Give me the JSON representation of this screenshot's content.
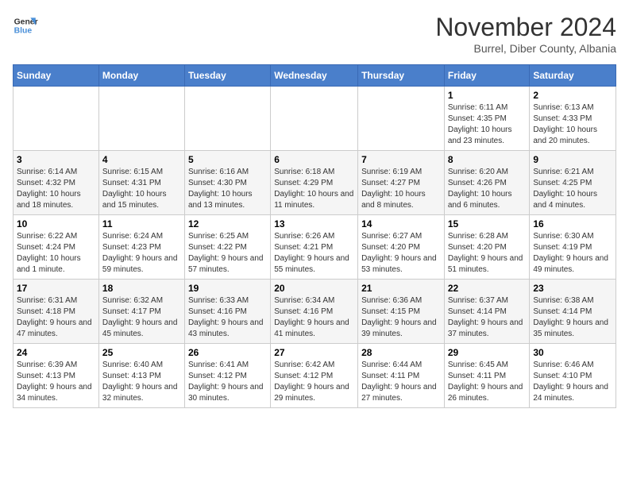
{
  "logo": {
    "line1": "General",
    "line2": "Blue"
  },
  "title": "November 2024",
  "subtitle": "Burrel, Diber County, Albania",
  "days_of_week": [
    "Sunday",
    "Monday",
    "Tuesday",
    "Wednesday",
    "Thursday",
    "Friday",
    "Saturday"
  ],
  "weeks": [
    [
      {
        "day": "",
        "info": ""
      },
      {
        "day": "",
        "info": ""
      },
      {
        "day": "",
        "info": ""
      },
      {
        "day": "",
        "info": ""
      },
      {
        "day": "",
        "info": ""
      },
      {
        "day": "1",
        "info": "Sunrise: 6:11 AM\nSunset: 4:35 PM\nDaylight: 10 hours and 23 minutes."
      },
      {
        "day": "2",
        "info": "Sunrise: 6:13 AM\nSunset: 4:33 PM\nDaylight: 10 hours and 20 minutes."
      }
    ],
    [
      {
        "day": "3",
        "info": "Sunrise: 6:14 AM\nSunset: 4:32 PM\nDaylight: 10 hours and 18 minutes."
      },
      {
        "day": "4",
        "info": "Sunrise: 6:15 AM\nSunset: 4:31 PM\nDaylight: 10 hours and 15 minutes."
      },
      {
        "day": "5",
        "info": "Sunrise: 6:16 AM\nSunset: 4:30 PM\nDaylight: 10 hours and 13 minutes."
      },
      {
        "day": "6",
        "info": "Sunrise: 6:18 AM\nSunset: 4:29 PM\nDaylight: 10 hours and 11 minutes."
      },
      {
        "day": "7",
        "info": "Sunrise: 6:19 AM\nSunset: 4:27 PM\nDaylight: 10 hours and 8 minutes."
      },
      {
        "day": "8",
        "info": "Sunrise: 6:20 AM\nSunset: 4:26 PM\nDaylight: 10 hours and 6 minutes."
      },
      {
        "day": "9",
        "info": "Sunrise: 6:21 AM\nSunset: 4:25 PM\nDaylight: 10 hours and 4 minutes."
      }
    ],
    [
      {
        "day": "10",
        "info": "Sunrise: 6:22 AM\nSunset: 4:24 PM\nDaylight: 10 hours and 1 minute."
      },
      {
        "day": "11",
        "info": "Sunrise: 6:24 AM\nSunset: 4:23 PM\nDaylight: 9 hours and 59 minutes."
      },
      {
        "day": "12",
        "info": "Sunrise: 6:25 AM\nSunset: 4:22 PM\nDaylight: 9 hours and 57 minutes."
      },
      {
        "day": "13",
        "info": "Sunrise: 6:26 AM\nSunset: 4:21 PM\nDaylight: 9 hours and 55 minutes."
      },
      {
        "day": "14",
        "info": "Sunrise: 6:27 AM\nSunset: 4:20 PM\nDaylight: 9 hours and 53 minutes."
      },
      {
        "day": "15",
        "info": "Sunrise: 6:28 AM\nSunset: 4:20 PM\nDaylight: 9 hours and 51 minutes."
      },
      {
        "day": "16",
        "info": "Sunrise: 6:30 AM\nSunset: 4:19 PM\nDaylight: 9 hours and 49 minutes."
      }
    ],
    [
      {
        "day": "17",
        "info": "Sunrise: 6:31 AM\nSunset: 4:18 PM\nDaylight: 9 hours and 47 minutes."
      },
      {
        "day": "18",
        "info": "Sunrise: 6:32 AM\nSunset: 4:17 PM\nDaylight: 9 hours and 45 minutes."
      },
      {
        "day": "19",
        "info": "Sunrise: 6:33 AM\nSunset: 4:16 PM\nDaylight: 9 hours and 43 minutes."
      },
      {
        "day": "20",
        "info": "Sunrise: 6:34 AM\nSunset: 4:16 PM\nDaylight: 9 hours and 41 minutes."
      },
      {
        "day": "21",
        "info": "Sunrise: 6:36 AM\nSunset: 4:15 PM\nDaylight: 9 hours and 39 minutes."
      },
      {
        "day": "22",
        "info": "Sunrise: 6:37 AM\nSunset: 4:14 PM\nDaylight: 9 hours and 37 minutes."
      },
      {
        "day": "23",
        "info": "Sunrise: 6:38 AM\nSunset: 4:14 PM\nDaylight: 9 hours and 35 minutes."
      }
    ],
    [
      {
        "day": "24",
        "info": "Sunrise: 6:39 AM\nSunset: 4:13 PM\nDaylight: 9 hours and 34 minutes."
      },
      {
        "day": "25",
        "info": "Sunrise: 6:40 AM\nSunset: 4:13 PM\nDaylight: 9 hours and 32 minutes."
      },
      {
        "day": "26",
        "info": "Sunrise: 6:41 AM\nSunset: 4:12 PM\nDaylight: 9 hours and 30 minutes."
      },
      {
        "day": "27",
        "info": "Sunrise: 6:42 AM\nSunset: 4:12 PM\nDaylight: 9 hours and 29 minutes."
      },
      {
        "day": "28",
        "info": "Sunrise: 6:44 AM\nSunset: 4:11 PM\nDaylight: 9 hours and 27 minutes."
      },
      {
        "day": "29",
        "info": "Sunrise: 6:45 AM\nSunset: 4:11 PM\nDaylight: 9 hours and 26 minutes."
      },
      {
        "day": "30",
        "info": "Sunrise: 6:46 AM\nSunset: 4:10 PM\nDaylight: 9 hours and 24 minutes."
      }
    ]
  ]
}
